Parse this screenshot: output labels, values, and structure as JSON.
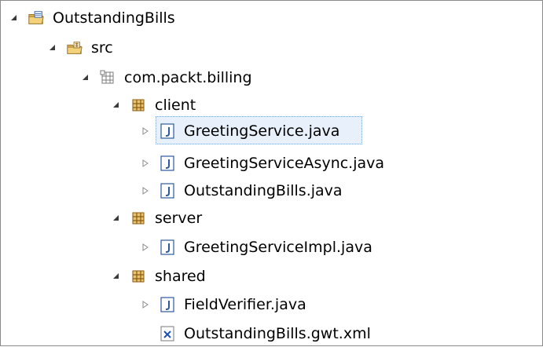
{
  "tree": {
    "items": [
      {
        "label": "OutstandingBills",
        "icon": "project-folder-icon",
        "expanded": true
      },
      {
        "label": "src",
        "icon": "source-folder-icon",
        "expanded": true
      },
      {
        "label": "com.packt.billing",
        "icon": "package-icon",
        "expanded": true
      },
      {
        "label": "client",
        "icon": "package-icon",
        "expanded": true
      },
      {
        "label": "GreetingService.java",
        "icon": "java-file-icon",
        "expanded": false,
        "selected": true
      },
      {
        "label": "GreetingServiceAsync.java",
        "icon": "java-file-icon",
        "expanded": false
      },
      {
        "label": "OutstandingBills.java",
        "icon": "java-file-icon",
        "expanded": false
      },
      {
        "label": "server",
        "icon": "package-icon",
        "expanded": true
      },
      {
        "label": "GreetingServiceImpl.java",
        "icon": "java-file-icon",
        "expanded": false
      },
      {
        "label": "shared",
        "icon": "package-icon",
        "expanded": true
      },
      {
        "label": "FieldVerifier.java",
        "icon": "java-file-icon",
        "expanded": false
      },
      {
        "label": "OutstandingBills.gwt.xml",
        "icon": "xml-file-icon"
      }
    ]
  }
}
